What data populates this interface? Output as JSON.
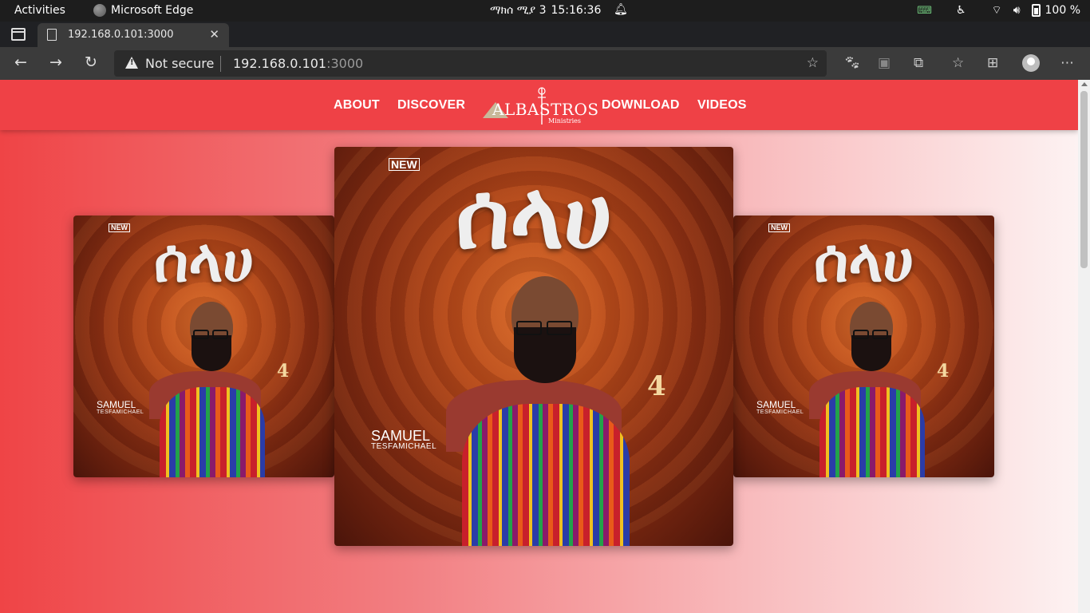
{
  "system": {
    "activities": "Activities",
    "app_name": "Microsoft Edge",
    "date": "ማክሰ ሚያ 3",
    "time": "15:16:36",
    "battery": "100 %"
  },
  "browser": {
    "tab_title": "192.168.0.101:3000",
    "security": "Not secure",
    "url_host": "192.168.0.101",
    "url_port": ":3000"
  },
  "site": {
    "nav": {
      "about": "ABOUT",
      "discover": "DISCOVER",
      "download": "DOWNLOAD",
      "videos": "VIDEOS"
    },
    "logo": {
      "word": "ALBASTROS",
      "sub": "Ministries"
    },
    "album": {
      "badge": "NEW",
      "title": "ሰላሀ",
      "artist_first": "SAMUEL",
      "artist_last": "TESFAMICHAEL",
      "number": "4"
    }
  },
  "icons": [
    "workspace-icon",
    "document-icon",
    "close-icon",
    "plus-icon",
    "minimize-icon",
    "maximize-icon",
    "back-icon",
    "forward-icon",
    "reload-icon",
    "warning-icon",
    "favorite-add-icon",
    "extension-icon",
    "favorites-icon",
    "collections-icon",
    "profile-icon",
    "more-icon",
    "accessibility-icon",
    "wifi-icon",
    "volume-icon",
    "battery-icon",
    "bell-icon"
  ]
}
